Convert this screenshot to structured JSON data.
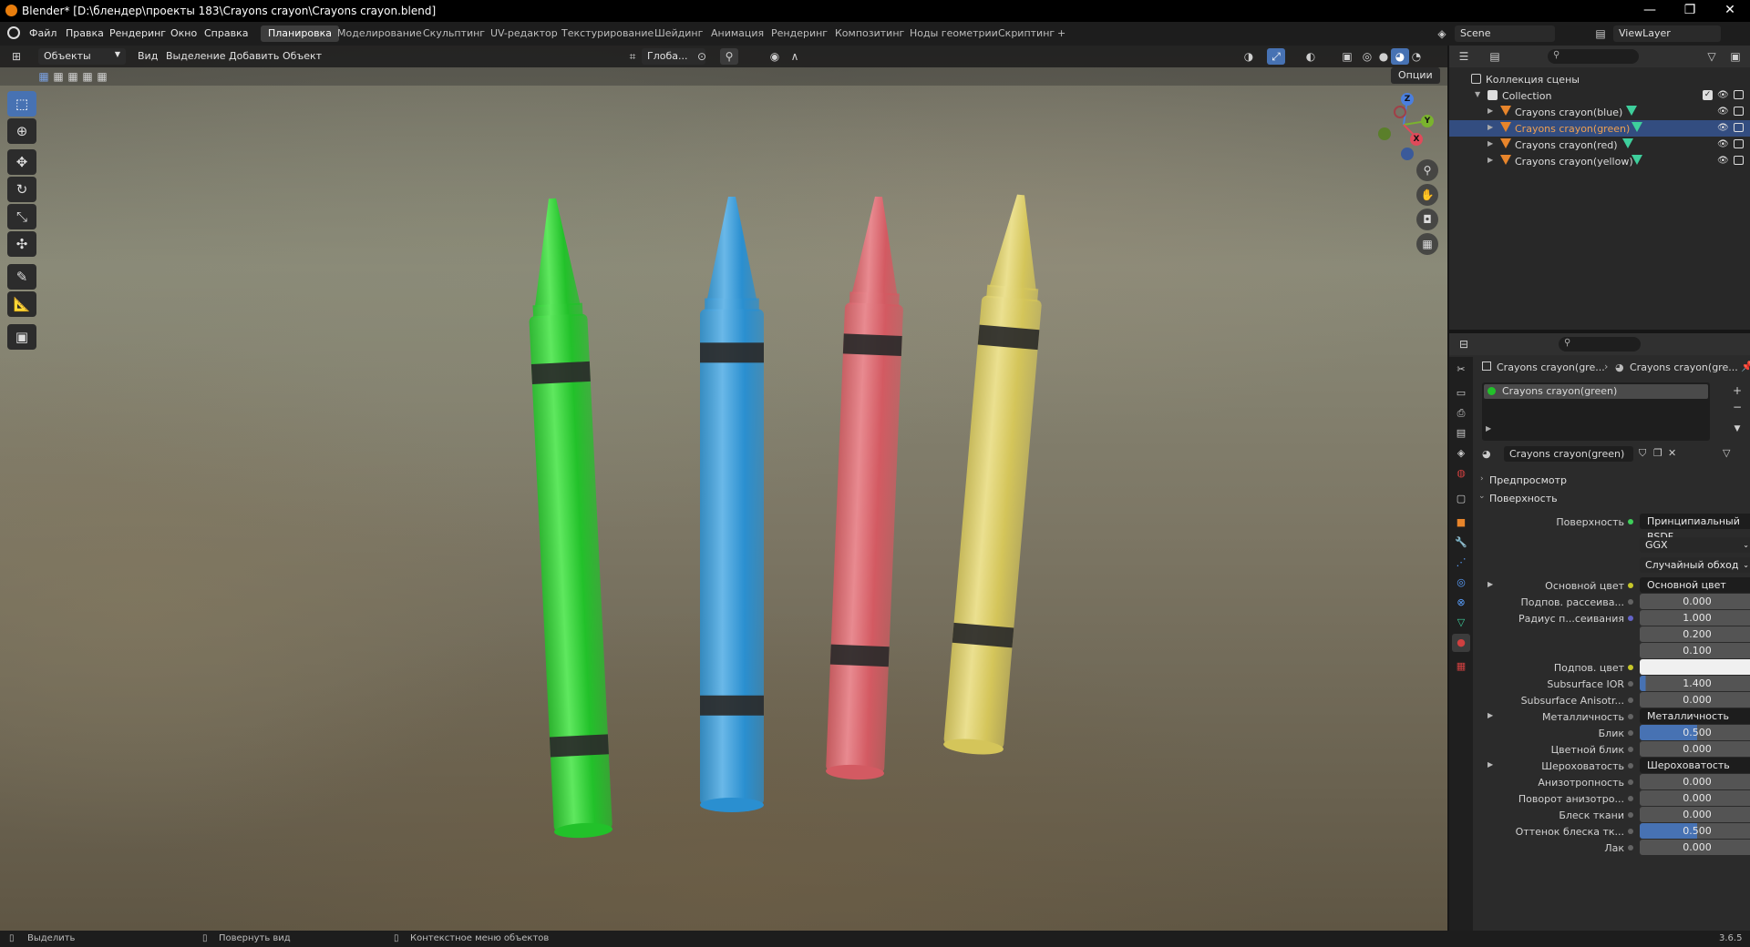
{
  "window": {
    "title": "Blender* [D:\\блендер\\проекты 183\\Crayons crayon\\Crayons crayon.blend]",
    "minimize": "—",
    "maximize": "❐",
    "close": "✕"
  },
  "menu": [
    "Файл",
    "Правка",
    "Рендеринг",
    "Окно",
    "Справка"
  ],
  "workspaces": {
    "tabs": [
      "Планировка",
      "Моделирование",
      "Скульптинг",
      "UV-редактор",
      "Текстурирование",
      "Шейдинг",
      "Анимация",
      "Рендеринг",
      "Композитинг",
      "Ноды геометрии",
      "Скриптинг"
    ],
    "active_index": 0,
    "add": "+"
  },
  "scene": {
    "name": "Scene",
    "view_layer": "ViewLayer"
  },
  "viewport_header": {
    "mode": "Объекты",
    "menus": [
      "Вид",
      "Выделение",
      "Добавить",
      "Объект"
    ],
    "transform_orientation": "Глоба...",
    "options": "Опции"
  },
  "outliner": {
    "root": "Коллекция сцены",
    "collection": "Collection",
    "objects": [
      {
        "name": "Crayons crayon(blue)",
        "selected": false
      },
      {
        "name": "Crayons crayon(green)",
        "selected": true
      },
      {
        "name": "Crayons crayon(red)",
        "selected": false
      },
      {
        "name": "Crayons crayon(yellow)",
        "selected": false
      }
    ]
  },
  "properties": {
    "breadcrumb_object": "Crayons crayon(gre...",
    "breadcrumb_material": "Crayons crayon(gre...",
    "material_slot": "Crayons crayon(green)",
    "material_name": "Crayons crayon(green)",
    "panels": {
      "preview": "Предпросмотр",
      "surface": "Поверхность"
    },
    "surface_label": "Поверхность",
    "surface_value": "Принципиальный BSDF",
    "distribution": "GGX",
    "subsurface_method": "Случайный обход",
    "rows": [
      {
        "label": "Основной цвет",
        "value": "Основной цвет",
        "kind": "link",
        "expand": true,
        "dot": "#c7c729"
      },
      {
        "label": "Подпов. рассеива...",
        "value": "0.000",
        "kind": "num",
        "dot": "#636363"
      },
      {
        "label": "Радиус п...сеивания",
        "value": "1.000",
        "kind": "num",
        "dot": "#6363c7"
      },
      {
        "label": "",
        "value": "0.200",
        "kind": "num",
        "nodot": true
      },
      {
        "label": "",
        "value": "0.100",
        "kind": "num",
        "nodot": true
      },
      {
        "label": "Подпов. цвет",
        "value": "",
        "kind": "white",
        "dot": "#c7c729"
      },
      {
        "label": "Subsurface IOR",
        "value": "1.400",
        "kind": "blue",
        "fill": 0.05,
        "dot": "#636363"
      },
      {
        "label": "Subsurface Anisotr...",
        "value": "0.000",
        "kind": "num",
        "dot": "#636363"
      },
      {
        "label": "Металличность",
        "value": "Металличность",
        "kind": "link",
        "expand": true,
        "dot": "#636363"
      },
      {
        "label": "Блик",
        "value": "0.500",
        "kind": "blue",
        "fill": 0.5,
        "dot": "#636363"
      },
      {
        "label": "Цветной блик",
        "value": "0.000",
        "kind": "num",
        "dot": "#636363"
      },
      {
        "label": "Шероховатость",
        "value": "Шероховатость",
        "kind": "link",
        "expand": true,
        "dot": "#636363"
      },
      {
        "label": "Анизотропность",
        "value": "0.000",
        "kind": "num",
        "dot": "#636363"
      },
      {
        "label": "Поворот анизотро...",
        "value": "0.000",
        "kind": "num",
        "dot": "#636363"
      },
      {
        "label": "Блеск ткани",
        "value": "0.000",
        "kind": "num",
        "dot": "#636363"
      },
      {
        "label": "Оттенок блеска тк...",
        "value": "0.500",
        "kind": "blue",
        "fill": 0.5,
        "dot": "#636363"
      },
      {
        "label": "Лак",
        "value": "0.000",
        "kind": "num",
        "dot": "#636363"
      }
    ]
  },
  "status_bar": {
    "select": "Выделить",
    "rotate": "Повернуть вид",
    "context": "Контекстное меню объектов",
    "version": "3.6.5"
  },
  "gizmo": {
    "x": "X",
    "y": "Y",
    "z": "Z"
  },
  "crayons": [
    {
      "color": "#22c12a",
      "highlight": "#5fe85f"
    },
    {
      "color": "#2a8fd0",
      "highlight": "#6ab8e8"
    },
    {
      "color": "#d35a62",
      "highlight": "#e88a90"
    },
    {
      "color": "#d4c55a",
      "highlight": "#ebe090"
    }
  ],
  "colors": {
    "accent": "#4772b3",
    "selected_row": "#334d80",
    "object_orange": "#e8852b",
    "mesh_green": "#3ecf9c"
  }
}
